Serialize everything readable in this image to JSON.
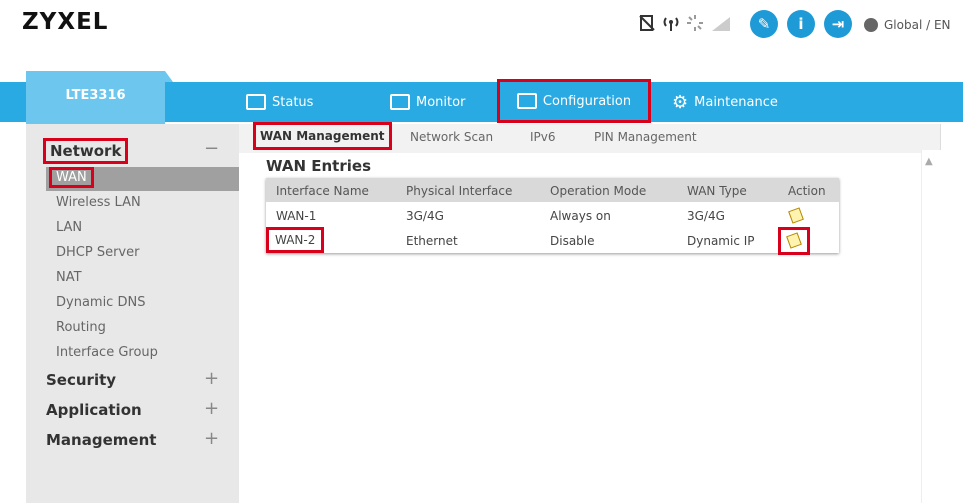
{
  "header": {
    "logo": "ZYXEL",
    "language": "Global / EN",
    "status_icons": [
      "sim-off-icon",
      "signal-tower-icon",
      "loading-icon",
      "signal-bars-icon"
    ],
    "buttons": [
      {
        "icon": "wizard-icon",
        "glyph": "✎"
      },
      {
        "icon": "info-icon",
        "glyph": "i"
      },
      {
        "icon": "logout-icon",
        "glyph": "⇥"
      }
    ]
  },
  "nav": {
    "device": "LTE3316",
    "items": [
      {
        "label": "Status",
        "icon": "status-icon"
      },
      {
        "label": "Monitor",
        "icon": "monitor-icon"
      },
      {
        "label": "Configuration",
        "icon": "configuration-icon"
      },
      {
        "label": "Maintenance",
        "icon": "maintenance-icon"
      }
    ]
  },
  "sidebar": {
    "sections": [
      {
        "label": "Network",
        "toggle": "−",
        "items": [
          "WAN",
          "Wireless LAN",
          "LAN",
          "DHCP Server",
          "NAT",
          "Dynamic DNS",
          "Routing",
          "Interface Group"
        ]
      },
      {
        "label": "Security",
        "toggle": "+"
      },
      {
        "label": "Application",
        "toggle": "+"
      },
      {
        "label": "Management",
        "toggle": "+"
      }
    ]
  },
  "subtabs": [
    "WAN Management",
    "Network Scan",
    "IPv6",
    "PIN Management"
  ],
  "wan": {
    "title": "WAN Entries",
    "columns": [
      "Interface Name",
      "Physical Interface",
      "Operation Mode",
      "WAN Type",
      "Action"
    ],
    "rows": [
      [
        "WAN-1",
        "3G/4G",
        "Always on",
        "3G/4G"
      ],
      [
        "WAN-2",
        "Ethernet",
        "Disable",
        "Dynamic IP"
      ]
    ]
  },
  "colors": {
    "nav": "#29aae2",
    "device_tab": "#6cc6ee",
    "highlight": "#d9001b"
  }
}
